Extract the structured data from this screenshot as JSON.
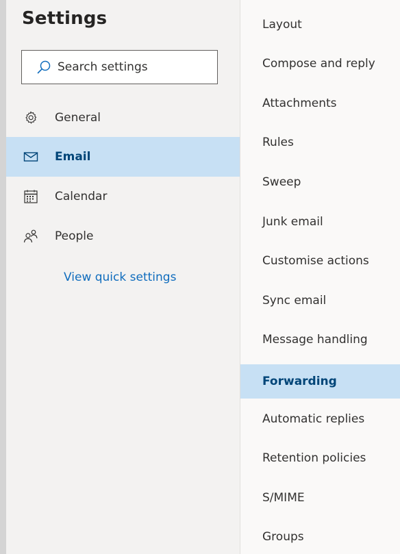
{
  "title": "Settings",
  "search": {
    "placeholder": "Search settings"
  },
  "nav": [
    {
      "label": "General",
      "icon": "gear-icon"
    },
    {
      "label": "Email",
      "icon": "mail-icon",
      "selected": true
    },
    {
      "label": "Calendar",
      "icon": "calendar-icon"
    },
    {
      "label": "People",
      "icon": "people-icon"
    }
  ],
  "quick_settings_link": "View quick settings",
  "subnav": [
    {
      "label": "Layout"
    },
    {
      "label": "Compose and reply"
    },
    {
      "label": "Attachments"
    },
    {
      "label": "Rules"
    },
    {
      "label": "Sweep"
    },
    {
      "label": "Junk email"
    },
    {
      "label": "Customise actions"
    },
    {
      "label": "Sync email"
    },
    {
      "label": "Message handling"
    },
    {
      "label": "Forwarding",
      "selected": true
    },
    {
      "label": "Automatic replies"
    },
    {
      "label": "Retention policies"
    },
    {
      "label": "S/MIME"
    },
    {
      "label": "Groups"
    }
  ],
  "colors": {
    "selected_bg": "#c7e0f4",
    "selected_text": "#004578",
    "link": "#0f6cbd",
    "left_pane_bg": "#f3f2f1",
    "right_pane_bg": "#faf9f8"
  }
}
